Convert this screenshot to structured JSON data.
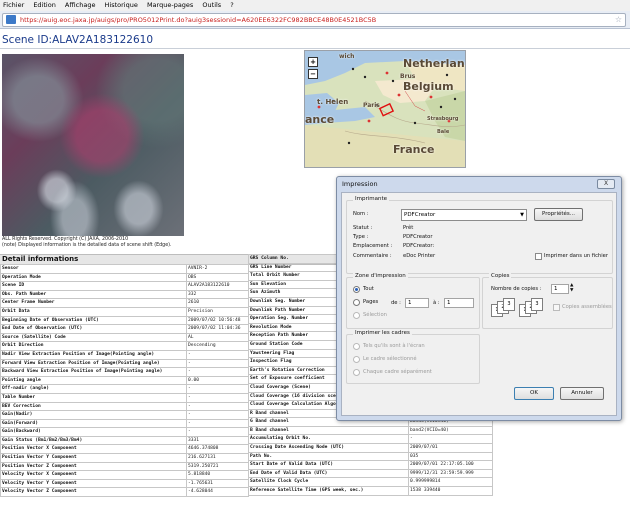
{
  "menu": [
    "Fichier",
    "Edition",
    "Affichage",
    "Historique",
    "Marque-pages",
    "Outils",
    "?"
  ],
  "address": {
    "url": "https://auig.eoc.jaxa.jp/auigs/pro/PRO5012Print.do?auig3sessionid=A620EE6322FC982BBCE48B0E4521BC5B"
  },
  "scene": {
    "title": "Scene ID:ALAV2A183122610",
    "copyright": "ALL Rights Reserved. Copyright (C) JAXA, 2006-2010",
    "note": "(note) Displayed information is the detailed data of scene shift (Edge)."
  },
  "map": {
    "labels": [
      "Netherlands",
      "Belgium",
      "France",
      "ance",
      "t. Helen",
      "Paris",
      "Brus",
      "Strasbourg",
      "Bale",
      "wich"
    ]
  },
  "details": {
    "heading": "Detail informations",
    "left_rows": [
      [
        "Sensor",
        "AVNIR-2"
      ],
      [
        "Operation Mode",
        "OBS"
      ],
      [
        "Scene ID",
        "ALAV2A183122610"
      ],
      [
        "Obs. Path Number",
        "332"
      ],
      [
        "Center Frame Number",
        "2610"
      ],
      [
        "Orbit Data",
        "Precision"
      ],
      [
        "Beginning Date of Observation (UTC)",
        "2009/07/02 10:56:48"
      ],
      [
        "End Date of Observation (UTC)",
        "2009/07/02 11:04:36"
      ],
      [
        "Source (Satellite) Code",
        "AL"
      ],
      [
        "Orbit Direction",
        "Descending"
      ],
      [
        "Nadir View Extraction Position of Image(Pointing angle)",
        "-"
      ],
      [
        "Forward View Extraction Position of Image(Pointing angle)",
        "-"
      ],
      [
        "Backward View Extraction Position of Image(Pointing angle)",
        "-"
      ],
      [
        "Pointing angle",
        "0.00"
      ],
      [
        "Off-nadir (angle)",
        "-"
      ],
      [
        "Table Number",
        "-"
      ],
      [
        "BEV Correction",
        "-"
      ],
      [
        "Gain(Nadir)",
        "-"
      ],
      [
        "Gain(Forward)",
        "-"
      ],
      [
        "Gain(Backward)",
        "-"
      ],
      [
        "Gain Status (Bm1/Bm2/Bm3/Bm4)",
        "3331"
      ],
      [
        "Position Vector X Component",
        "4646.374808"
      ],
      [
        "Position Vector Y Component",
        "216.627131"
      ],
      [
        "Position Vector Z Component",
        "5319.250721"
      ],
      [
        "Velocity Vector X Component",
        "5.818840"
      ],
      [
        "Velocity Vector Y Component",
        "-1.765631"
      ],
      [
        "Velocity Vector Z Component",
        "-4.628044"
      ]
    ],
    "right_rows": [
      [
        "GRS Column No.",
        ""
      ],
      [
        "GRS Line Number",
        ""
      ],
      [
        "Total Orbit Number",
        ""
      ],
      [
        "Sun Elevation",
        ""
      ],
      [
        "Sun Azimuth",
        ""
      ],
      [
        "Downlink Seg. Number",
        ""
      ],
      [
        "Downlink Path Number",
        ""
      ],
      [
        "Operation Seg. Number",
        ""
      ],
      [
        "Revolution Mode",
        ""
      ],
      [
        "Reception Path Number",
        ""
      ],
      [
        "Ground Station Code",
        ""
      ],
      [
        "Yawsteering Flag",
        ""
      ],
      [
        "Inspection Flag",
        ""
      ],
      [
        "Earth's Rotation Correction",
        ""
      ],
      [
        "Set of Exposure coefficient",
        ""
      ],
      [
        "Cloud Coverage (Scene)",
        "-"
      ],
      [
        "Cloud Coverage (16 division scene)",
        "0000000000001000"
      ],
      [
        "Cloud Coverage Calculation Algorithm Version",
        "V08"
      ],
      [
        "R Band channel",
        "band4(VCIO=40)"
      ],
      [
        "G Band channel",
        "band3(VCIO=40)"
      ],
      [
        "B Band channel",
        "band2(VCIO=40)"
      ],
      [
        "Accumulating Orbit No.",
        "-"
      ],
      [
        "Crossing Date Ascending Node (UTC)",
        "2009/07/01"
      ],
      [
        "Path No.",
        "035"
      ],
      [
        "Start Date of Valid Data (UTC)",
        "2009/07/01 22:17:05.100"
      ],
      [
        "End Date of Valid Data (UTC)",
        "9999/12/31 23:59:59.999"
      ],
      [
        "Satellite Clock Cycle",
        "0.999999814"
      ],
      [
        "Reference Satellite Time (GPS week, sec.)",
        "1538 339440"
      ]
    ]
  },
  "print_dialog": {
    "title": "Impression",
    "close": "X",
    "printer_group": "Imprimante",
    "name_label": "Nom :",
    "name_value": "PDFCreator",
    "properties_button": "Propriétés...",
    "status_label": "Statut :",
    "status_value": "Prêt",
    "type_label": "Type :",
    "type_value": "PDFCreator",
    "location_label": "Emplacement :",
    "location_value": "PDFCreator:",
    "comment_label": "Commentaire :",
    "comment_value": "eDoc Printer",
    "print_to_file": "Imprimer dans un fichier",
    "range_group": "Zone d'impression",
    "range_all": "Tout",
    "range_pages": "Pages",
    "from_label": "de :",
    "from_value": "1",
    "to_label": "à :",
    "to_value": "1",
    "range_selection": "Sélection",
    "copies_group": "Copies",
    "copies_label": "Nombre de copies :",
    "copies_value": "1",
    "collate": "Copies assemblées",
    "frames_group": "Imprimer les cadres",
    "frames_screen": "Tels qu'ils sont à l'écran",
    "frames_selected": "Le cadre sélectionné",
    "frames_each": "Chaque cadre séparément",
    "ok": "OK",
    "cancel": "Annuler"
  }
}
